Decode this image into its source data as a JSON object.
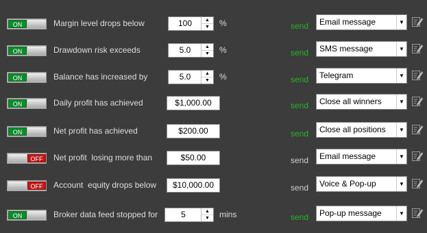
{
  "rows": [
    {
      "state": "ON",
      "label": "Margin level drops below",
      "value": "100",
      "value_type": "spin",
      "unit": "%",
      "send": "send",
      "send_color": "green",
      "action": "Email message"
    },
    {
      "state": "ON",
      "label": "Drawdown risk exceeds",
      "value": "5.0",
      "value_type": "spin",
      "unit": "%",
      "send": "send",
      "send_color": "green",
      "action": "SMS message"
    },
    {
      "state": "ON",
      "label": "Balance has increased by",
      "value": "5.0",
      "value_type": "spin",
      "unit": "%",
      "send": "send",
      "send_color": "green",
      "action": "Telegram"
    },
    {
      "state": "ON",
      "label": "Daily profit has achieved",
      "value": "$1,000.00",
      "value_type": "box",
      "unit": "",
      "send": "send",
      "send_color": "green",
      "action": "Close all winners"
    },
    {
      "state": "ON",
      "label": "Net profit has achieved",
      "value": "$200.00",
      "value_type": "box",
      "unit": "",
      "send": "send",
      "send_color": "green",
      "action": "Close all positions"
    },
    {
      "state": "OFF",
      "label": "Net profit  losing more than",
      "value": "$50.00",
      "value_type": "box",
      "unit": "",
      "send": "send",
      "send_color": "grey",
      "action": "Email message"
    },
    {
      "state": "OFF",
      "label": "Account  equity drops below",
      "value": "$10,000.00",
      "value_type": "box",
      "unit": "",
      "send": "send",
      "send_color": "grey",
      "action": "Voice & Pop-up"
    },
    {
      "state": "ON",
      "label": "Broker data feed stopped for",
      "value": "5",
      "value_type": "spin",
      "unit": "mins",
      "send": "send",
      "send_color": "green",
      "action": "Pop-up message"
    }
  ],
  "colors": {
    "background": "#3c3c3c",
    "on": "#0f8a2c",
    "off": "#c01818",
    "send_active": "#26b526"
  },
  "icons": {
    "spin_up": "arrow-up-icon",
    "spin_down": "arrow-down-icon",
    "dropdown": "chevron-down-icon",
    "edit": "edit-note-icon"
  }
}
